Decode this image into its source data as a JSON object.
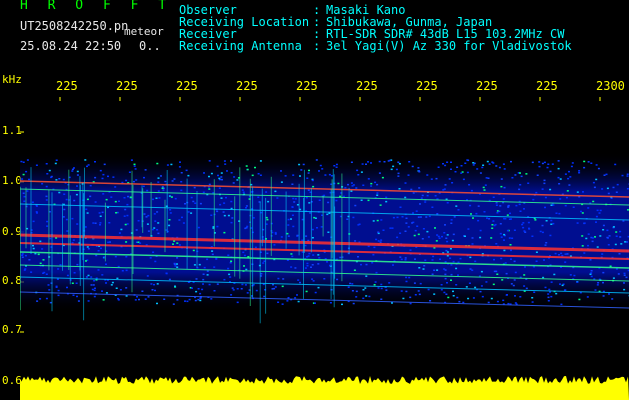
{
  "header": {
    "program": "H R O F F T",
    "filename": "UT2508242250.pn",
    "meteor_label": "meteor",
    "datetime": "25.08.24 22:50",
    "count": "0..",
    "fields": [
      {
        "key": "Observer",
        "value": "Masaki Kano"
      },
      {
        "key": "Receiving Location",
        "value": "Shibukawa, Gunma, Japan"
      },
      {
        "key": "Receiver",
        "value": "RTL-SDR SDR# 43dB L15 103.2MHz CW"
      },
      {
        "key": "Receiving Antenna",
        "value": "3el Yagi(V) Az 330 for Vladivostok"
      }
    ]
  },
  "axes": {
    "y_unit": "kHz",
    "x_ticks": [
      "225",
      "225",
      "225",
      "225",
      "225",
      "225",
      "225",
      "225",
      "225",
      "2300"
    ],
    "y_ticks": [
      "1.1",
      "1.0",
      "0.9",
      "0.8",
      "0.7",
      "0.6"
    ]
  },
  "colors": {
    "background": "#000000",
    "header_cyan": "#00ffff",
    "header_green": "#00ff00",
    "axis_yellow": "#ffff00",
    "noise_floor": "#ffff00",
    "spectrum_low": "#0000a0",
    "spectrum_mid": "#00ff80",
    "spectrum_high": "#ff3030"
  }
}
